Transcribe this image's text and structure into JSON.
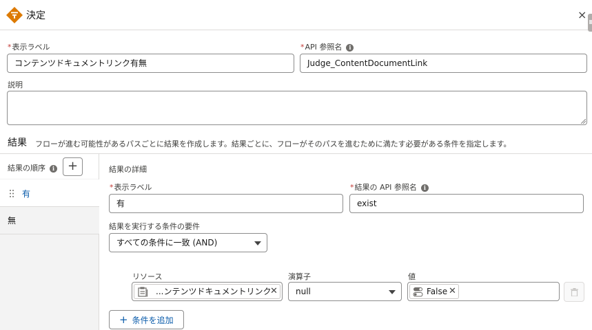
{
  "header": {
    "title": "決定",
    "close_glyph": "×",
    "icon": "decision-icon",
    "icon_color": "#dd7a01"
  },
  "form": {
    "label_field": {
      "label": "表示ラベル",
      "value": "コンテンツドキュメントリンク有無"
    },
    "api_field": {
      "label": "API 参照名",
      "value": "Judge_ContentDocumentLink"
    },
    "description_field": {
      "label": "説明",
      "value": ""
    }
  },
  "results": {
    "title": "結果",
    "description": "フローが進む可能性があるパスごとに結果を作成します。結果ごとに、フローがそのパスを進むために満たす必要がある条件を指定します。"
  },
  "order_panel": {
    "title": "結果の順序",
    "add_glyph": "+",
    "items": [
      {
        "label": "有",
        "active": true
      },
      {
        "label": "無",
        "active": false
      }
    ]
  },
  "detail": {
    "title": "結果の詳細",
    "label_field": {
      "label": "表示ラベル",
      "value": "有"
    },
    "api_field": {
      "label": "結果の API 参照名",
      "value": "exist"
    },
    "requirement": {
      "label": "結果を実行する条件の要件",
      "value": "すべての条件に一致 (AND)"
    },
    "condition": {
      "resource_label": "リソース",
      "resource_value": "...ンテンツドキュメントリンク",
      "operator_label": "演算子",
      "operator_value": "null",
      "value_label": "値",
      "value_value": "False"
    },
    "add_condition_label": "条件を追加",
    "add_condition_glyph": "+"
  },
  "colors": {
    "required": "#c23934",
    "link": "#0b5cab",
    "border": "#8c8c8c"
  }
}
